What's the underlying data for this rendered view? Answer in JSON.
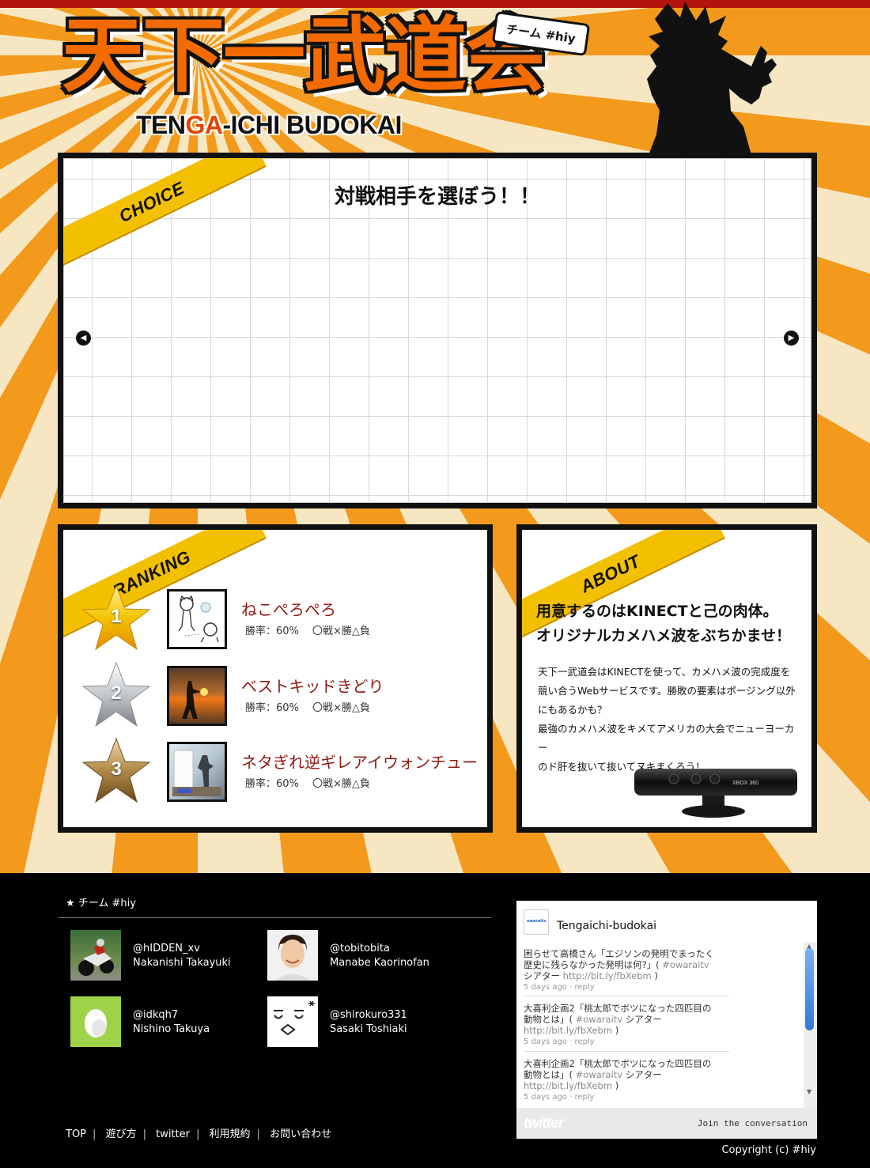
{
  "header": {
    "logo_main": "天下一武道会",
    "logo_sub_prefix": "TEN",
    "logo_sub_highlight": "GA",
    "logo_sub_suffix": "-ICHI BUDOKAI",
    "team_bubble": "チーム #hiy"
  },
  "choice": {
    "ribbon": "CHOICE",
    "title": "対戦相手を選ぼう！！",
    "prev_icon": "arrow-left-icon",
    "next_icon": "arrow-right-icon"
  },
  "ranking": {
    "ribbon": "RANKING",
    "items": [
      {
        "rank": "1",
        "name": "ねこぺろぺろ",
        "stats": "勝率：60%　 〇戦×勝△負",
        "medal": "gold"
      },
      {
        "rank": "2",
        "name": "ベストキッドきどり",
        "stats": "勝率：60%　 〇戦×勝△負",
        "medal": "silver"
      },
      {
        "rank": "3",
        "name": "ネタぎれ逆ギレアイウォンチュー",
        "stats": "勝率：60%　 〇戦×勝△負",
        "medal": "bronze"
      }
    ]
  },
  "about": {
    "ribbon": "ABOUT",
    "headline_1": "用意するのはKINECTと己の肉体。",
    "headline_2": "オリジナルカメハメ波をぶちかませ！",
    "body_1": "天下一武道会はKINECTを使って、カメハメ波の完成度を",
    "body_2": "競い合うWebサービスです。勝敗の要素はポージング以外",
    "body_3": "にもあるかも？",
    "body_4": "最強のカメハメ波をキメてアメリカの大会でニューヨーカー",
    "body_5": "のド肝を抜いて抜いてヌキまくろう！",
    "device_label": "XBOX 360"
  },
  "footer": {
    "team_heading": "★ チーム #hiy",
    "members": [
      {
        "handle": "@hIDDEN_xv",
        "name": "Nakanishi Takayuki"
      },
      {
        "handle": "@tobitobita",
        "name": "Manabe Kaorinofan"
      },
      {
        "handle": "@idkqh7",
        "name": "Nishino Takuya"
      },
      {
        "handle": "@shirokuro331",
        "name": "Sasaki Toshiaki"
      }
    ],
    "nav": [
      "TOP",
      "遊び方",
      "twitter",
      "利用規約",
      "お問い合わせ"
    ],
    "copyright": "Copyright (c) #hiy"
  },
  "twitter": {
    "title": "Tengaichi-budokai",
    "avatar_text": "owaraitv",
    "tweets": [
      {
        "line1": "困らせて高橋さん「エジソンの発明でまったく",
        "line2_a": "歴史に残らなかった発明は何?」(",
        "hashtag": " #owaraitv",
        "line3_a": "シアター ",
        "link": "http://bit.ly/fbXebm",
        "line3_b": " )",
        "meta": "5 days ago · reply"
      },
      {
        "line1": "大喜利企画2「桃太郎でボツになった四匹目の",
        "line2_a": "動物とは」(",
        "hashtag": " #owaraitv",
        "line3_a": " シアター",
        "link": "http://bit.ly/fbXebm",
        "line3_b": " )",
        "meta": "5 days ago · reply"
      },
      {
        "line1": "大喜利企画2「桃太郎でボツになった四匹目の",
        "line2_a": "動物とは」(",
        "hashtag": " #owaraitv",
        "line3_a": " シアター",
        "link": "http://bit.ly/fbXebm",
        "line3_b": " )",
        "meta": "5 days ago · reply"
      }
    ],
    "logo": "twitter",
    "join": "Join the conversation"
  }
}
